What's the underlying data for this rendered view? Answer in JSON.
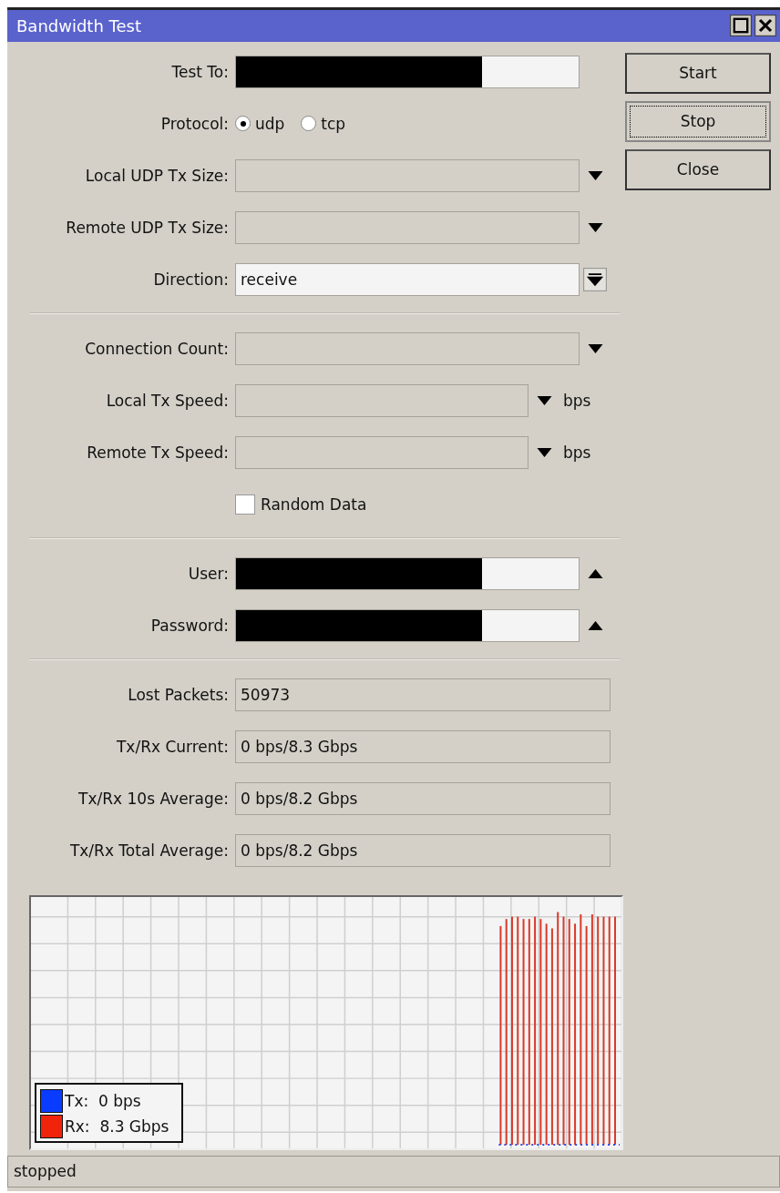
{
  "window": {
    "title": "Bandwidth Test"
  },
  "buttons": [
    {
      "label": "Start",
      "focused": false
    },
    {
      "label": "Stop",
      "focused": true
    },
    {
      "label": "Close",
      "focused": false
    }
  ],
  "sections": [
    [
      {
        "kind": "text",
        "label": "Test To:",
        "redacted": true,
        "enabled": true,
        "collapsible": false
      },
      {
        "kind": "radio",
        "label": "Protocol:",
        "options": [
          {
            "label": "udp",
            "selected": true
          },
          {
            "label": "tcp",
            "selected": false
          }
        ]
      },
      {
        "kind": "combo",
        "label": "Local UDP Tx Size:",
        "enabled": false
      },
      {
        "kind": "combo",
        "label": "Remote UDP Tx Size:",
        "enabled": false
      },
      {
        "kind": "select",
        "label": "Direction:",
        "value": "receive",
        "enabled": true
      }
    ],
    [
      {
        "kind": "combo",
        "label": "Connection Count:",
        "enabled": false
      },
      {
        "kind": "combo",
        "label": "Local Tx Speed:",
        "enabled": false,
        "unit": "bps"
      },
      {
        "kind": "combo",
        "label": "Remote Tx Speed:",
        "enabled": false,
        "unit": "bps"
      },
      {
        "kind": "checkbox",
        "label": "Random Data",
        "checked": false
      }
    ],
    [
      {
        "kind": "text",
        "label": "User:",
        "redacted": true,
        "enabled": true,
        "collapsible": true
      },
      {
        "kind": "text",
        "label": "Password:",
        "redacted": true,
        "enabled": true,
        "collapsible": true
      }
    ],
    [
      {
        "kind": "readonly",
        "label": "Lost Packets:",
        "value": "50973"
      },
      {
        "kind": "readonly",
        "label": "Tx/Rx Current:",
        "value": "0 bps/8.3 Gbps"
      },
      {
        "kind": "readonly",
        "label": "Tx/Rx 10s Average:",
        "value": "0 bps/8.2 Gbps"
      },
      {
        "kind": "readonly",
        "label": "Tx/Rx Total Average:",
        "value": "0 bps/8.2 Gbps"
      }
    ]
  ],
  "legend": [
    {
      "label": "Tx:  0 bps",
      "color": "#0a3cff"
    },
    {
      "label": "Rx:  8.3 Gbps",
      "color": "#f0240a"
    }
  ],
  "status_bar": "stopped"
}
